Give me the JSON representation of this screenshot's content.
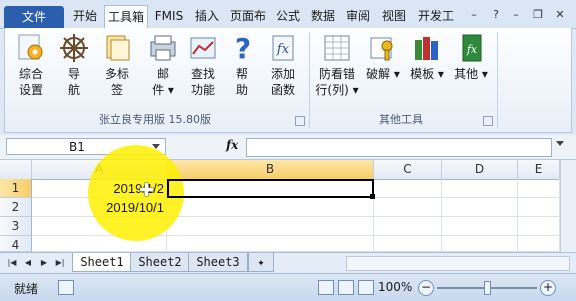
{
  "tabs": [
    "文件",
    "开始",
    "工具箱",
    "FMIS",
    "插入",
    "页面布",
    "公式",
    "数据",
    "审阅",
    "视图",
    "开发工"
  ],
  "ribbon": {
    "group1_buttons": [
      {
        "label1": "综合",
        "label2": "设置",
        "icon": "gear-icon"
      },
      {
        "label1": "导",
        "label2": "航",
        "icon": "compass-wheel-icon"
      },
      {
        "label1": "多标",
        "label2": "签",
        "icon": "multi-tab-icon"
      },
      {
        "label1": "邮",
        "label2": "件 ▾",
        "icon": "mail-printer-icon"
      },
      {
        "label1": "查找",
        "label2": "功能",
        "icon": "search-chart-icon"
      },
      {
        "label1": "帮",
        "label2": "助",
        "icon": "help-icon"
      },
      {
        "label1": "添加",
        "label2": "函数",
        "icon": "add-function-icon"
      }
    ],
    "group1_label": "张立良专用版 15.80版",
    "group2_buttons": [
      {
        "label1": "防看错",
        "label2": "行(列) ▾",
        "icon": "grid-view-icon"
      },
      {
        "label1": "",
        "label2": "破解 ▾",
        "icon": "key-lock-icon"
      },
      {
        "label1": "",
        "label2": "模板 ▾",
        "icon": "template-books-icon"
      },
      {
        "label1": "",
        "label2": "其他 ▾",
        "icon": "excel-file-icon"
      }
    ],
    "group2_label": "其他工具"
  },
  "formula_bar": {
    "name_box": "B1",
    "fx": "fx",
    "formula": ""
  },
  "grid": {
    "columns": [
      "A",
      "B",
      "C",
      "D",
      "E"
    ],
    "rows": [
      "1",
      "2",
      "3",
      "4"
    ],
    "cells": {
      "A1": "2019/1/2",
      "A2": "2019/10/1"
    }
  },
  "sheets": [
    "Sheet1",
    "Sheet2",
    "Sheet3"
  ],
  "status": {
    "ready": "就绪",
    "zoom": "100%",
    "zoom_minus": "−",
    "zoom_plus": "+"
  },
  "window": {
    "minimize": "–",
    "help": "?",
    "restore": "❐",
    "close": "✕"
  }
}
